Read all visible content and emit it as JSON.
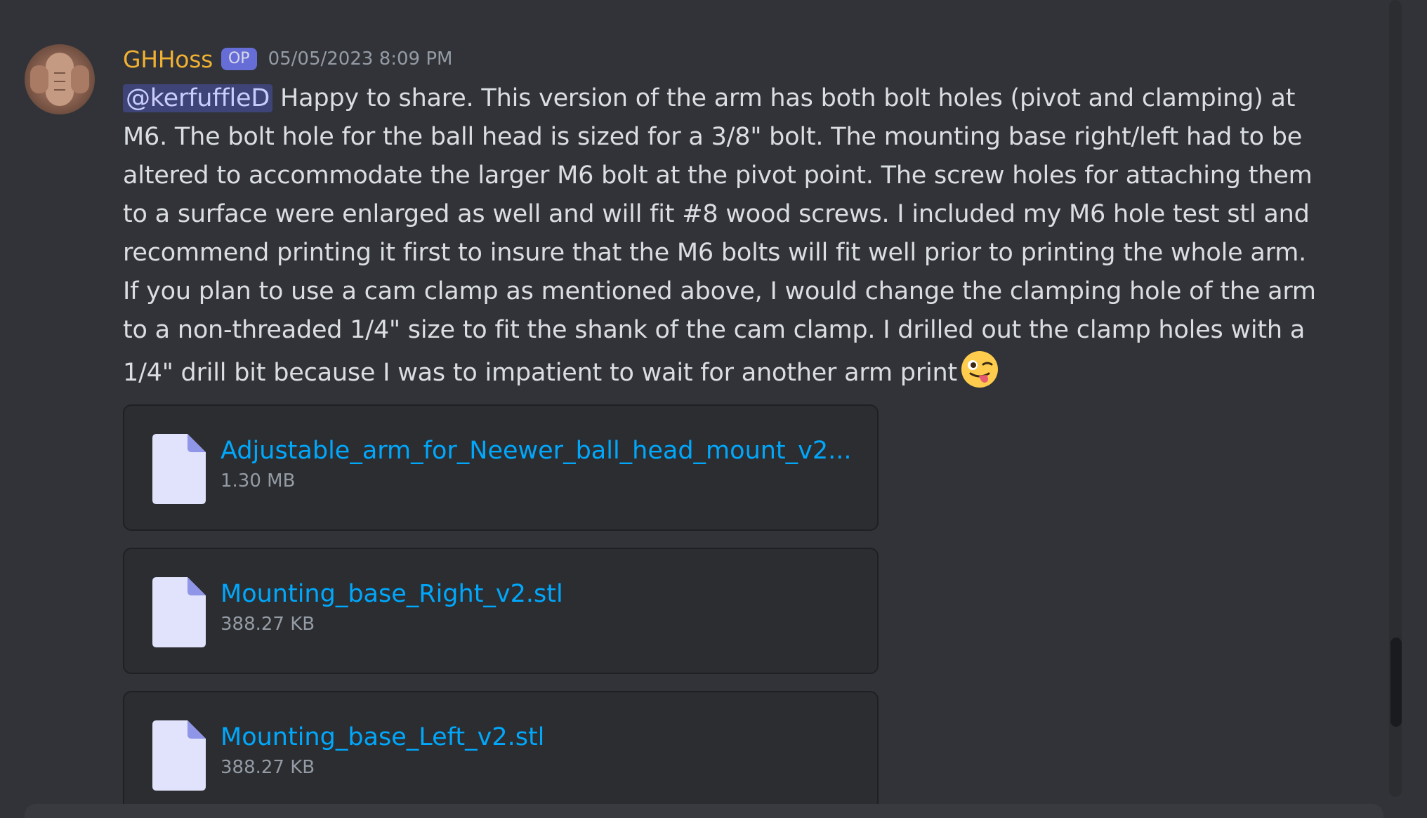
{
  "message": {
    "username": "GHHoss",
    "badge": "OP",
    "timestamp": "05/05/2023 8:09 PM",
    "mention": "@kerfuffleD",
    "text": " Happy to share.  This version of the arm has both bolt holes (pivot and clamping) at M6.  The bolt hole for the ball head is sized for a 3/8\" bolt.  The mounting base right/left had to be altered to accommodate the larger M6 bolt at the pivot point.  The screw holes for attaching them to a surface were enlarged as well and will fit #8 wood screws.  I included my M6 hole test stl and recommend printing it first to insure that the M6 bolts will fit well prior to printing the whole arm.  If you plan to use a cam clamp as mentioned above, I would change the clamping hole of the arm to a non-threaded 1/4\" size to fit the shank of the cam clamp.  I drilled out the clamp holes with a 1/4\" drill bit because I was to impatient to wait for another arm print",
    "emoji": "winking-face-with-tongue-icon"
  },
  "attachments": [
    {
      "name": "Adjustable_arm_for_Neewer_ball_head_mount_v2...",
      "size": "1.30 MB"
    },
    {
      "name": "Mounting_base_Right_v2.stl",
      "size": "388.27 KB"
    },
    {
      "name": "Mounting_base_Left_v2.stl",
      "size": "388.27 KB"
    }
  ],
  "colors": {
    "background": "#313338",
    "username": "#f0b132",
    "link": "#00a8fc",
    "text": "#dbdee1",
    "muted": "#949ba4",
    "file_icon": "#e1e2fc"
  }
}
